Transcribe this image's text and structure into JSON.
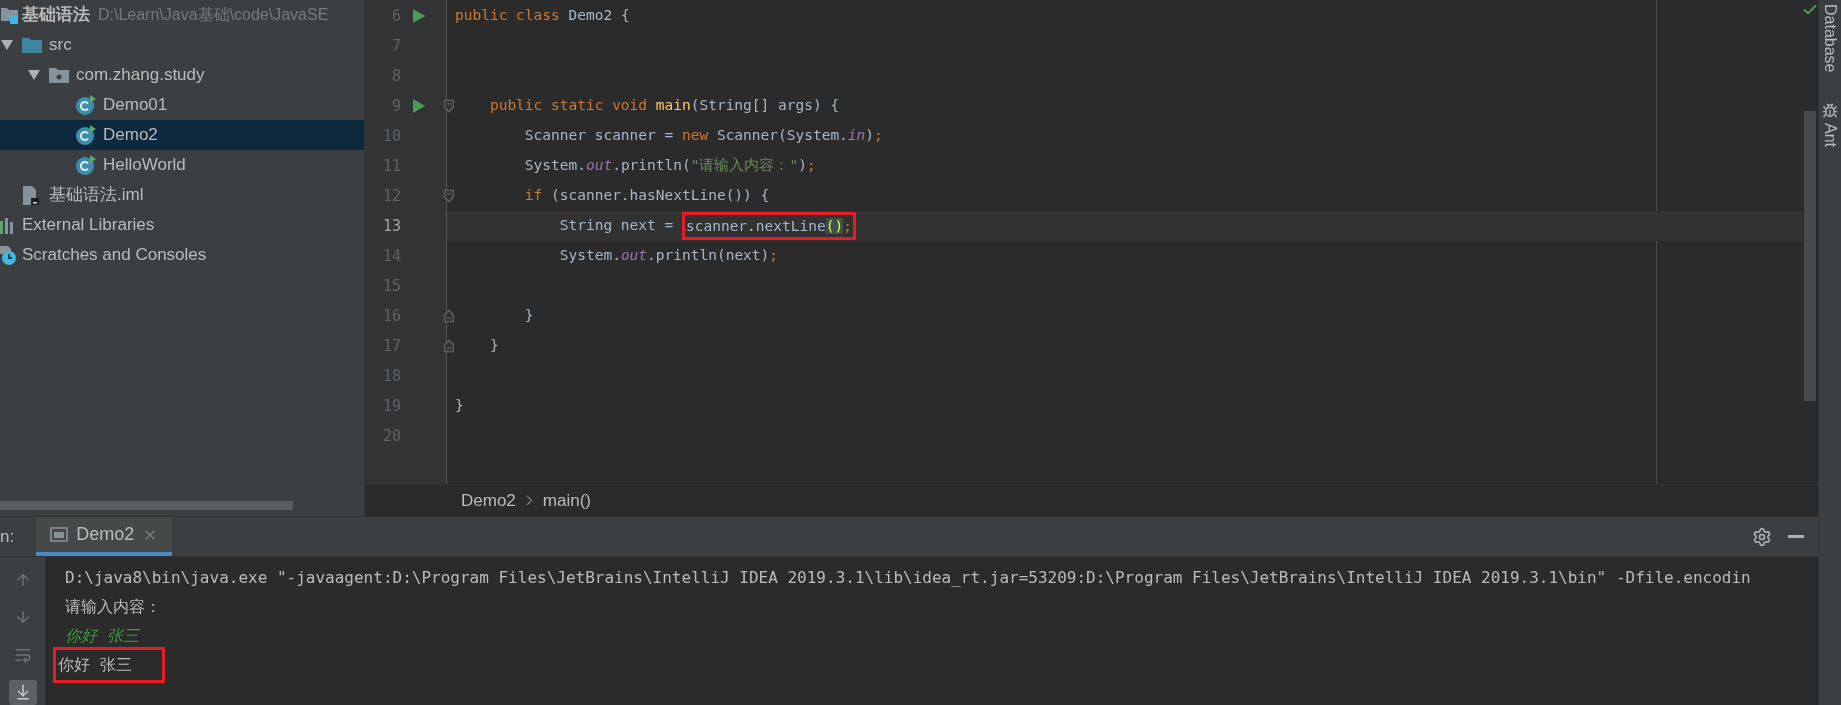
{
  "project_tree": {
    "items": [
      {
        "kind": "module",
        "label": "基础语法",
        "path": "D:\\Learn\\Java基础\\code\\JavaSE",
        "selected": false,
        "children": [
          {
            "kind": "source-folder",
            "label": "src",
            "expanded": true,
            "selected": false,
            "children": [
              {
                "kind": "package",
                "label": "com.zhang.study",
                "expanded": true,
                "selected": false,
                "children": [
                  {
                    "kind": "class",
                    "label": "Demo01",
                    "selected": false
                  },
                  {
                    "kind": "class",
                    "label": "Demo2",
                    "selected": true
                  },
                  {
                    "kind": "class",
                    "label": "HelloWorld",
                    "selected": false
                  }
                ]
              }
            ]
          },
          {
            "kind": "iml-file",
            "label": "基础语法.iml",
            "selected": false
          }
        ]
      },
      {
        "kind": "libraries",
        "label": "External Libraries",
        "selected": false
      },
      {
        "kind": "scratches",
        "label": "Scratches and Consoles",
        "selected": false
      }
    ]
  },
  "editor": {
    "lines": [
      {
        "number": "6",
        "gutter_icons": [
          {
            "kind": "run"
          }
        ],
        "current": false,
        "tokens": [
          {
            "kind": "keyword",
            "text": "public class "
          },
          {
            "kind": "plain",
            "text": "Demo2 {"
          }
        ]
      },
      {
        "number": "7",
        "current": false
      },
      {
        "number": "8",
        "current": false
      },
      {
        "number": "9",
        "gutter_icons": [
          {
            "kind": "run"
          },
          {
            "kind": "fold-start"
          }
        ],
        "current": false,
        "tokens": [
          {
            "kind": "keyword",
            "text": "    public static void "
          },
          {
            "kind": "method",
            "text": "main"
          },
          {
            "kind": "plain",
            "text": "(String[] args) {"
          }
        ]
      },
      {
        "number": "10",
        "current": false,
        "tokens": [
          {
            "kind": "plain",
            "text": "        Scanner scanner = "
          },
          {
            "kind": "keyword",
            "text": "new "
          },
          {
            "kind": "plain",
            "text": "Scanner(System."
          },
          {
            "kind": "static",
            "text": "in"
          },
          {
            "kind": "plain",
            "text": ")"
          },
          {
            "kind": "keyword",
            "text": ";"
          }
        ]
      },
      {
        "number": "11",
        "current": false,
        "tokens": [
          {
            "kind": "plain",
            "text": "        System."
          },
          {
            "kind": "static",
            "text": "out"
          },
          {
            "kind": "plain",
            "text": ".println("
          },
          {
            "kind": "string",
            "text": "\"请输入内容：\""
          },
          {
            "kind": "plain",
            "text": ")"
          },
          {
            "kind": "keyword",
            "text": ";"
          }
        ]
      },
      {
        "number": "12",
        "gutter_icons": [
          {
            "kind": "fold-start"
          }
        ],
        "current": false,
        "tokens": [
          {
            "kind": "keyword",
            "text": "        if "
          },
          {
            "kind": "plain",
            "text": "(scanner.hasNextLine()) {"
          }
        ]
      },
      {
        "number": "13",
        "current": true,
        "tokens": [
          {
            "kind": "plain",
            "text": "            String next = "
          },
          {
            "kind": "boxed",
            "tokens": [
              {
                "kind": "plain",
                "text": "scanner.nextLine"
              },
              {
                "kind": "matched",
                "text": "()"
              },
              {
                "kind": "keyword",
                "text": ";"
              }
            ]
          }
        ]
      },
      {
        "number": "14",
        "current": false,
        "tokens": [
          {
            "kind": "plain",
            "text": "            System."
          },
          {
            "kind": "static",
            "text": "out"
          },
          {
            "kind": "plain",
            "text": ".println(next)"
          },
          {
            "kind": "keyword",
            "text": ";"
          }
        ]
      },
      {
        "number": "15",
        "current": false
      },
      {
        "number": "16",
        "gutter_icons": [
          {
            "kind": "fold-end"
          }
        ],
        "current": false,
        "tokens": [
          {
            "kind": "plain",
            "text": "        }"
          }
        ]
      },
      {
        "number": "17",
        "gutter_icons": [
          {
            "kind": "fold-end"
          }
        ],
        "current": false,
        "tokens": [
          {
            "kind": "plain",
            "text": "    }"
          }
        ]
      },
      {
        "number": "18",
        "current": false
      },
      {
        "number": "19",
        "current": false,
        "tokens": [
          {
            "kind": "plain",
            "text": "}"
          }
        ]
      },
      {
        "number": "20",
        "current": false
      }
    ],
    "breadcrumbs": [
      "Demo2",
      "main()"
    ]
  },
  "run_panel": {
    "tool_label": "n:",
    "tabs": [
      {
        "label": "Demo2",
        "selected": true
      }
    ],
    "toolbar": [
      {
        "kind": "previous",
        "selected": false
      },
      {
        "kind": "next",
        "selected": false
      },
      {
        "kind": "soft-wrap",
        "selected": false
      },
      {
        "kind": "scroll-to-end",
        "selected": true
      }
    ],
    "lines": [
      {
        "kind": "command",
        "text": "D:\\java8\\bin\\java.exe \"-javaagent:D:\\Program Files\\JetBrains\\IntelliJ IDEA 2019.3.1\\lib\\idea_rt.jar=53209:D:\\Program Files\\JetBrains\\IntelliJ IDEA 2019.3.1\\bin\" -Dfile.encodin",
        "boxed": false
      },
      {
        "kind": "output",
        "text": "请输入内容：",
        "boxed": false
      },
      {
        "kind": "input",
        "text": "你好 张三",
        "boxed": false
      },
      {
        "kind": "output",
        "text": "你好 张三",
        "boxed": true
      }
    ]
  },
  "side_strip": [
    {
      "kind": "plain",
      "label": "Database"
    },
    {
      "kind": "ant",
      "label": "Ant"
    }
  ]
}
